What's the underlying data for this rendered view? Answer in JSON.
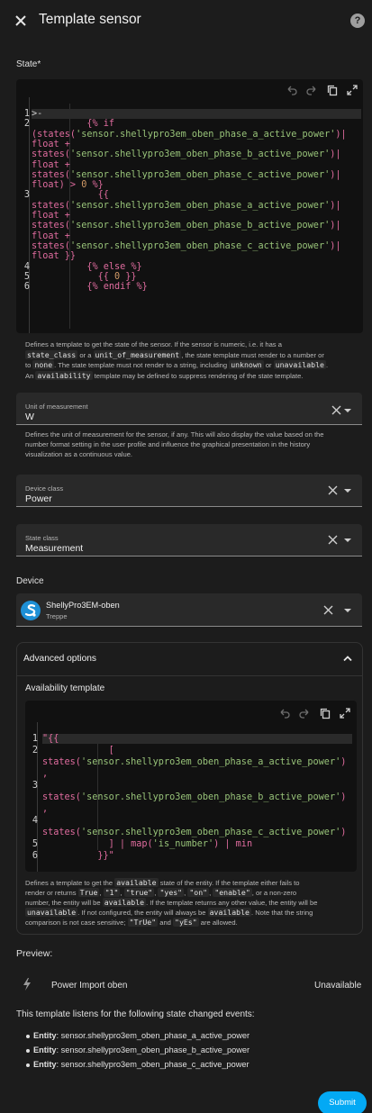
{
  "dialog": {
    "title": "Template sensor",
    "help_icon": "help-circle-icon",
    "close_icon": "close-icon"
  },
  "state": {
    "label": "State*",
    "lines": [
      {
        "n": "1",
        "parts": [
          {
            "t": ">-",
            "c": "txt"
          }
        ]
      },
      {
        "n": "2",
        "parts": [
          {
            "t": "          {% if",
            "c": "tpl"
          }
        ]
      },
      {
        "n": "",
        "parts": [
          {
            "t": "(states(",
            "c": "tpl"
          },
          {
            "t": "'sensor.shellypro3em_oben_phase_a_active_power'",
            "c": "str"
          },
          {
            "t": ")|",
            "c": "tpl"
          }
        ]
      },
      {
        "n": "",
        "parts": [
          {
            "t": "float +",
            "c": "tpl"
          }
        ]
      },
      {
        "n": "",
        "parts": [
          {
            "t": "states(",
            "c": "tpl"
          },
          {
            "t": "'sensor.shellypro3em_oben_phase_b_active_power'",
            "c": "str"
          },
          {
            "t": ")|",
            "c": "tpl"
          }
        ]
      },
      {
        "n": "",
        "parts": [
          {
            "t": "float +",
            "c": "tpl"
          }
        ]
      },
      {
        "n": "",
        "parts": [
          {
            "t": "states(",
            "c": "tpl"
          },
          {
            "t": "'sensor.shellypro3em_oben_phase_c_active_power'",
            "c": "str"
          },
          {
            "t": ")|",
            "c": "tpl"
          }
        ]
      },
      {
        "n": "",
        "parts": [
          {
            "t": "float) > ",
            "c": "tpl"
          },
          {
            "t": "0",
            "c": "num"
          },
          {
            "t": " %}",
            "c": "tpl"
          }
        ]
      },
      {
        "n": "3",
        "parts": [
          {
            "t": "            {{",
            "c": "tpl"
          }
        ]
      },
      {
        "n": "",
        "parts": [
          {
            "t": "states(",
            "c": "tpl"
          },
          {
            "t": "'sensor.shellypro3em_oben_phase_a_active_power'",
            "c": "str"
          },
          {
            "t": ")|",
            "c": "tpl"
          }
        ]
      },
      {
        "n": "",
        "parts": [
          {
            "t": "float +",
            "c": "tpl"
          }
        ]
      },
      {
        "n": "",
        "parts": [
          {
            "t": "states(",
            "c": "tpl"
          },
          {
            "t": "'sensor.shellypro3em_oben_phase_b_active_power'",
            "c": "str"
          },
          {
            "t": ")|",
            "c": "tpl"
          }
        ]
      },
      {
        "n": "",
        "parts": [
          {
            "t": "float +",
            "c": "tpl"
          }
        ]
      },
      {
        "n": "",
        "parts": [
          {
            "t": "states(",
            "c": "tpl"
          },
          {
            "t": "'sensor.shellypro3em_oben_phase_c_active_power'",
            "c": "str"
          },
          {
            "t": ")|",
            "c": "tpl"
          }
        ]
      },
      {
        "n": "",
        "parts": [
          {
            "t": "float }}",
            "c": "tpl"
          }
        ]
      },
      {
        "n": "4",
        "parts": [
          {
            "t": "          {% else %}",
            "c": "tpl"
          }
        ]
      },
      {
        "n": "5",
        "parts": [
          {
            "t": "            {{ ",
            "c": "tpl"
          },
          {
            "t": "0",
            "c": "num"
          },
          {
            "t": " }}",
            "c": "tpl"
          }
        ]
      },
      {
        "n": "6",
        "parts": [
          {
            "t": "          {% endif %}",
            "c": "tpl"
          }
        ]
      }
    ],
    "help": [
      [
        {
          "t": "Defines a template to get the state of the sensor. If the sensor is numeric, i.e. it has a "
        }
      ],
      [
        {
          "t": "state_class",
          "m": true
        },
        {
          "t": " or a "
        },
        {
          "t": "unit_of_measurement",
          "m": true
        },
        {
          "t": ", the state template must render to a number or"
        }
      ],
      [
        {
          "t": "to "
        },
        {
          "t": "none",
          "m": true
        },
        {
          "t": ". The state template must not render to a string, including "
        },
        {
          "t": "unknown",
          "m": true
        },
        {
          "t": " or "
        },
        {
          "t": "unavailable",
          "m": true
        },
        {
          "t": "."
        }
      ],
      [
        {
          "t": "An "
        },
        {
          "t": "availability",
          "m": true
        },
        {
          "t": " template may be defined to suppress rendering of the state template."
        }
      ]
    ]
  },
  "unit": {
    "label": "Unit of measurement",
    "value": "W",
    "help": "Defines the unit of measurement for the sensor, if any. This will also display the value based on the number format setting in the user profile and influence the graphical presentation in the history visualization as a continuous value."
  },
  "device_class": {
    "label": "Device class",
    "value": "Power"
  },
  "state_class": {
    "label": "State class",
    "value": "Measurement"
  },
  "device": {
    "section_label": "Device",
    "name": "ShellyPro3EM-oben",
    "area": "Treppe"
  },
  "advanced": {
    "title": "Advanced options",
    "availability_label": "Availability template",
    "lines": [
      {
        "n": "1",
        "parts": [
          {
            "t": "\"{{",
            "c": "tpl"
          }
        ]
      },
      {
        "n": "2",
        "parts": [
          {
            "t": "            [",
            "c": "tpl"
          }
        ]
      },
      {
        "n": "",
        "parts": [
          {
            "t": "states(",
            "c": "tpl"
          },
          {
            "t": "'sensor.shellypro3em_oben_phase_a_active_power'",
            "c": "str"
          },
          {
            "t": ")",
            "c": "tpl"
          }
        ]
      },
      {
        "n": "",
        "parts": [
          {
            "t": ",",
            "c": "tpl"
          }
        ]
      },
      {
        "n": "3",
        "parts": [
          {
            "t": "",
            "c": "tpl"
          }
        ]
      },
      {
        "n": "",
        "parts": [
          {
            "t": "states(",
            "c": "tpl"
          },
          {
            "t": "'sensor.shellypro3em_oben_phase_b_active_power'",
            "c": "str"
          },
          {
            "t": ")",
            "c": "tpl"
          }
        ]
      },
      {
        "n": "",
        "parts": [
          {
            "t": ",",
            "c": "tpl"
          }
        ]
      },
      {
        "n": "4",
        "parts": [
          {
            "t": "",
            "c": "tpl"
          }
        ]
      },
      {
        "n": "",
        "parts": [
          {
            "t": "states(",
            "c": "tpl"
          },
          {
            "t": "'sensor.shellypro3em_oben_phase_c_active_power'",
            "c": "str"
          },
          {
            "t": ")",
            "c": "tpl"
          }
        ]
      },
      {
        "n": "5",
        "parts": [
          {
            "t": "            ] | map(",
            "c": "tpl"
          },
          {
            "t": "'is_number'",
            "c": "str"
          },
          {
            "t": ") | min",
            "c": "tpl"
          }
        ]
      },
      {
        "n": "6",
        "parts": [
          {
            "t": "          }}\"",
            "c": "tpl"
          }
        ]
      }
    ],
    "help": [
      [
        {
          "t": "Defines a template to get the "
        },
        {
          "t": "available",
          "m": true
        },
        {
          "t": " state of the entity. If the template either fails to"
        }
      ],
      [
        {
          "t": "render or returns "
        },
        {
          "t": "True",
          "m": true
        },
        {
          "t": ", "
        },
        {
          "t": "\"1\"",
          "m": true
        },
        {
          "t": ", "
        },
        {
          "t": "\"true\"",
          "m": true
        },
        {
          "t": ", "
        },
        {
          "t": "\"yes\"",
          "m": true
        },
        {
          "t": ", "
        },
        {
          "t": "\"on\"",
          "m": true
        },
        {
          "t": ", "
        },
        {
          "t": "\"enable\"",
          "m": true
        },
        {
          "t": ", or a non-zero"
        }
      ],
      [
        {
          "t": "number, the entity will be "
        },
        {
          "t": "available",
          "m": true
        },
        {
          "t": ". If the template returns any other value, the entity will be"
        }
      ],
      [
        {
          "t": "unavailable",
          "m": true
        },
        {
          "t": ". If not configured, the entity will always be "
        },
        {
          "t": "available",
          "m": true
        },
        {
          "t": ". Note that the string"
        }
      ],
      [
        {
          "t": "comparison is not case sensitive; "
        },
        {
          "t": "\"TrUe\"",
          "m": true
        },
        {
          "t": " and "
        },
        {
          "t": "\"yEs\"",
          "m": true
        },
        {
          "t": " are allowed."
        }
      ]
    ]
  },
  "preview": {
    "label": "Preview:",
    "icon": "flash-icon",
    "entity_name": "Power Import oben",
    "entity_state": "Unavailable",
    "listen_text": "This template listens for the following state changed events:",
    "entities": [
      {
        "prefix": "Entity",
        "value": ": sensor.shellypro3em_oben_phase_a_active_power"
      },
      {
        "prefix": "Entity",
        "value": ": sensor.shellypro3em_oben_phase_b_active_power"
      },
      {
        "prefix": "Entity",
        "value": ": sensor.shellypro3em_oben_phase_c_active_power"
      }
    ]
  },
  "actions": {
    "submit_label": "Submit"
  },
  "colors": {
    "accent": "#03a9f4",
    "template": "#e06c9f",
    "string": "#98c379",
    "number": "#d19a66"
  }
}
